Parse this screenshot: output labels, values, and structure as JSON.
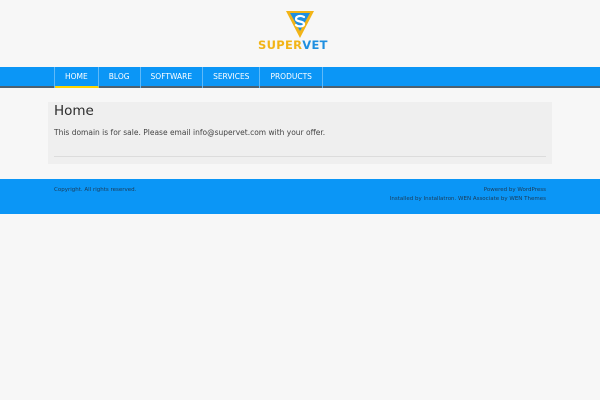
{
  "logo": {
    "text_super": "SUPER",
    "text_vet": "VET",
    "icon": "supervet-logo-icon"
  },
  "nav": {
    "items": [
      {
        "label": "HOME",
        "active": true
      },
      {
        "label": "BLOG",
        "active": false
      },
      {
        "label": "SOFTWARE",
        "active": false
      },
      {
        "label": "SERVICES",
        "active": false
      },
      {
        "label": "PRODUCTS",
        "active": false
      }
    ]
  },
  "main": {
    "title": "Home",
    "text": "This domain is for sale. Please email info@supervet.com with your offer."
  },
  "footer": {
    "copyright": "Copyright. All rights reserved.",
    "powered_by": "Powered by WordPress",
    "installed_by": "Installed by Installatron. WEN Associate by WEN Themes"
  },
  "colors": {
    "nav_bg": "#0b96f6",
    "active_underline": "#ffd400",
    "logo_yellow": "#f2b417",
    "logo_blue": "#1f8fe0"
  }
}
